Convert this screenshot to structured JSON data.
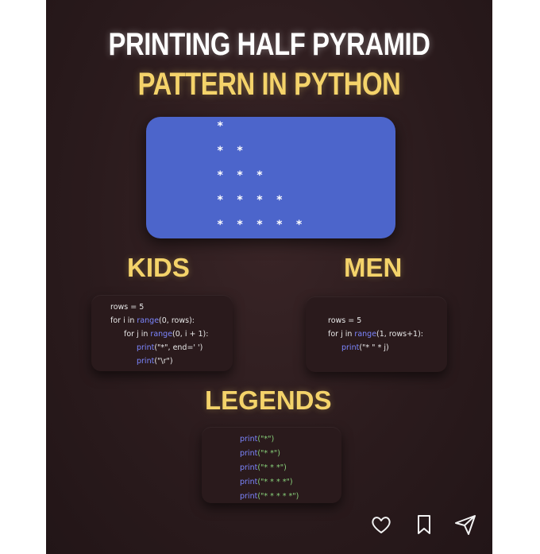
{
  "title": {
    "line1": "PRINTING HALF PYRAMID",
    "line2": "PATTERN IN PYTHON"
  },
  "pattern": {
    "rows": [
      "*",
      "* *",
      "* * *",
      "* * * *",
      "* * * * *"
    ]
  },
  "sections": {
    "kids": {
      "label": "KIDS",
      "code": [
        {
          "kw": "rows = 5"
        },
        {
          "pre": "for i in ",
          "fn": "range",
          "post": "(0, rows):"
        },
        {
          "pre": "for j in ",
          "fn": "range",
          "post": "(0, i + 1):"
        },
        {
          "fn": "print",
          "post": "(\"*\", end=' ')"
        },
        {
          "fn": "print",
          "post": "(\"\\r\")"
        }
      ]
    },
    "men": {
      "label": "MEN",
      "code": [
        {
          "kw": "rows = 5"
        },
        {
          "pre": "for j in ",
          "fn": "range",
          "post": "(1, rows+1):"
        },
        {
          "fn": "print",
          "post": "(\"* \" * j)"
        }
      ]
    },
    "legends": {
      "label": "LEGENDS",
      "code": [
        {
          "fn": "print",
          "str": "(\"*\")"
        },
        {
          "fn": "print",
          "str": "(\"* *\")"
        },
        {
          "fn": "print",
          "str": "(\"* * *\")"
        },
        {
          "fn": "print",
          "str": "(\"* * * *\")"
        },
        {
          "fn": "print",
          "str": "(\"* * * * *\")"
        }
      ]
    }
  },
  "actions": {
    "like": "heart-icon",
    "save": "bookmark-icon",
    "share": "send-icon"
  }
}
